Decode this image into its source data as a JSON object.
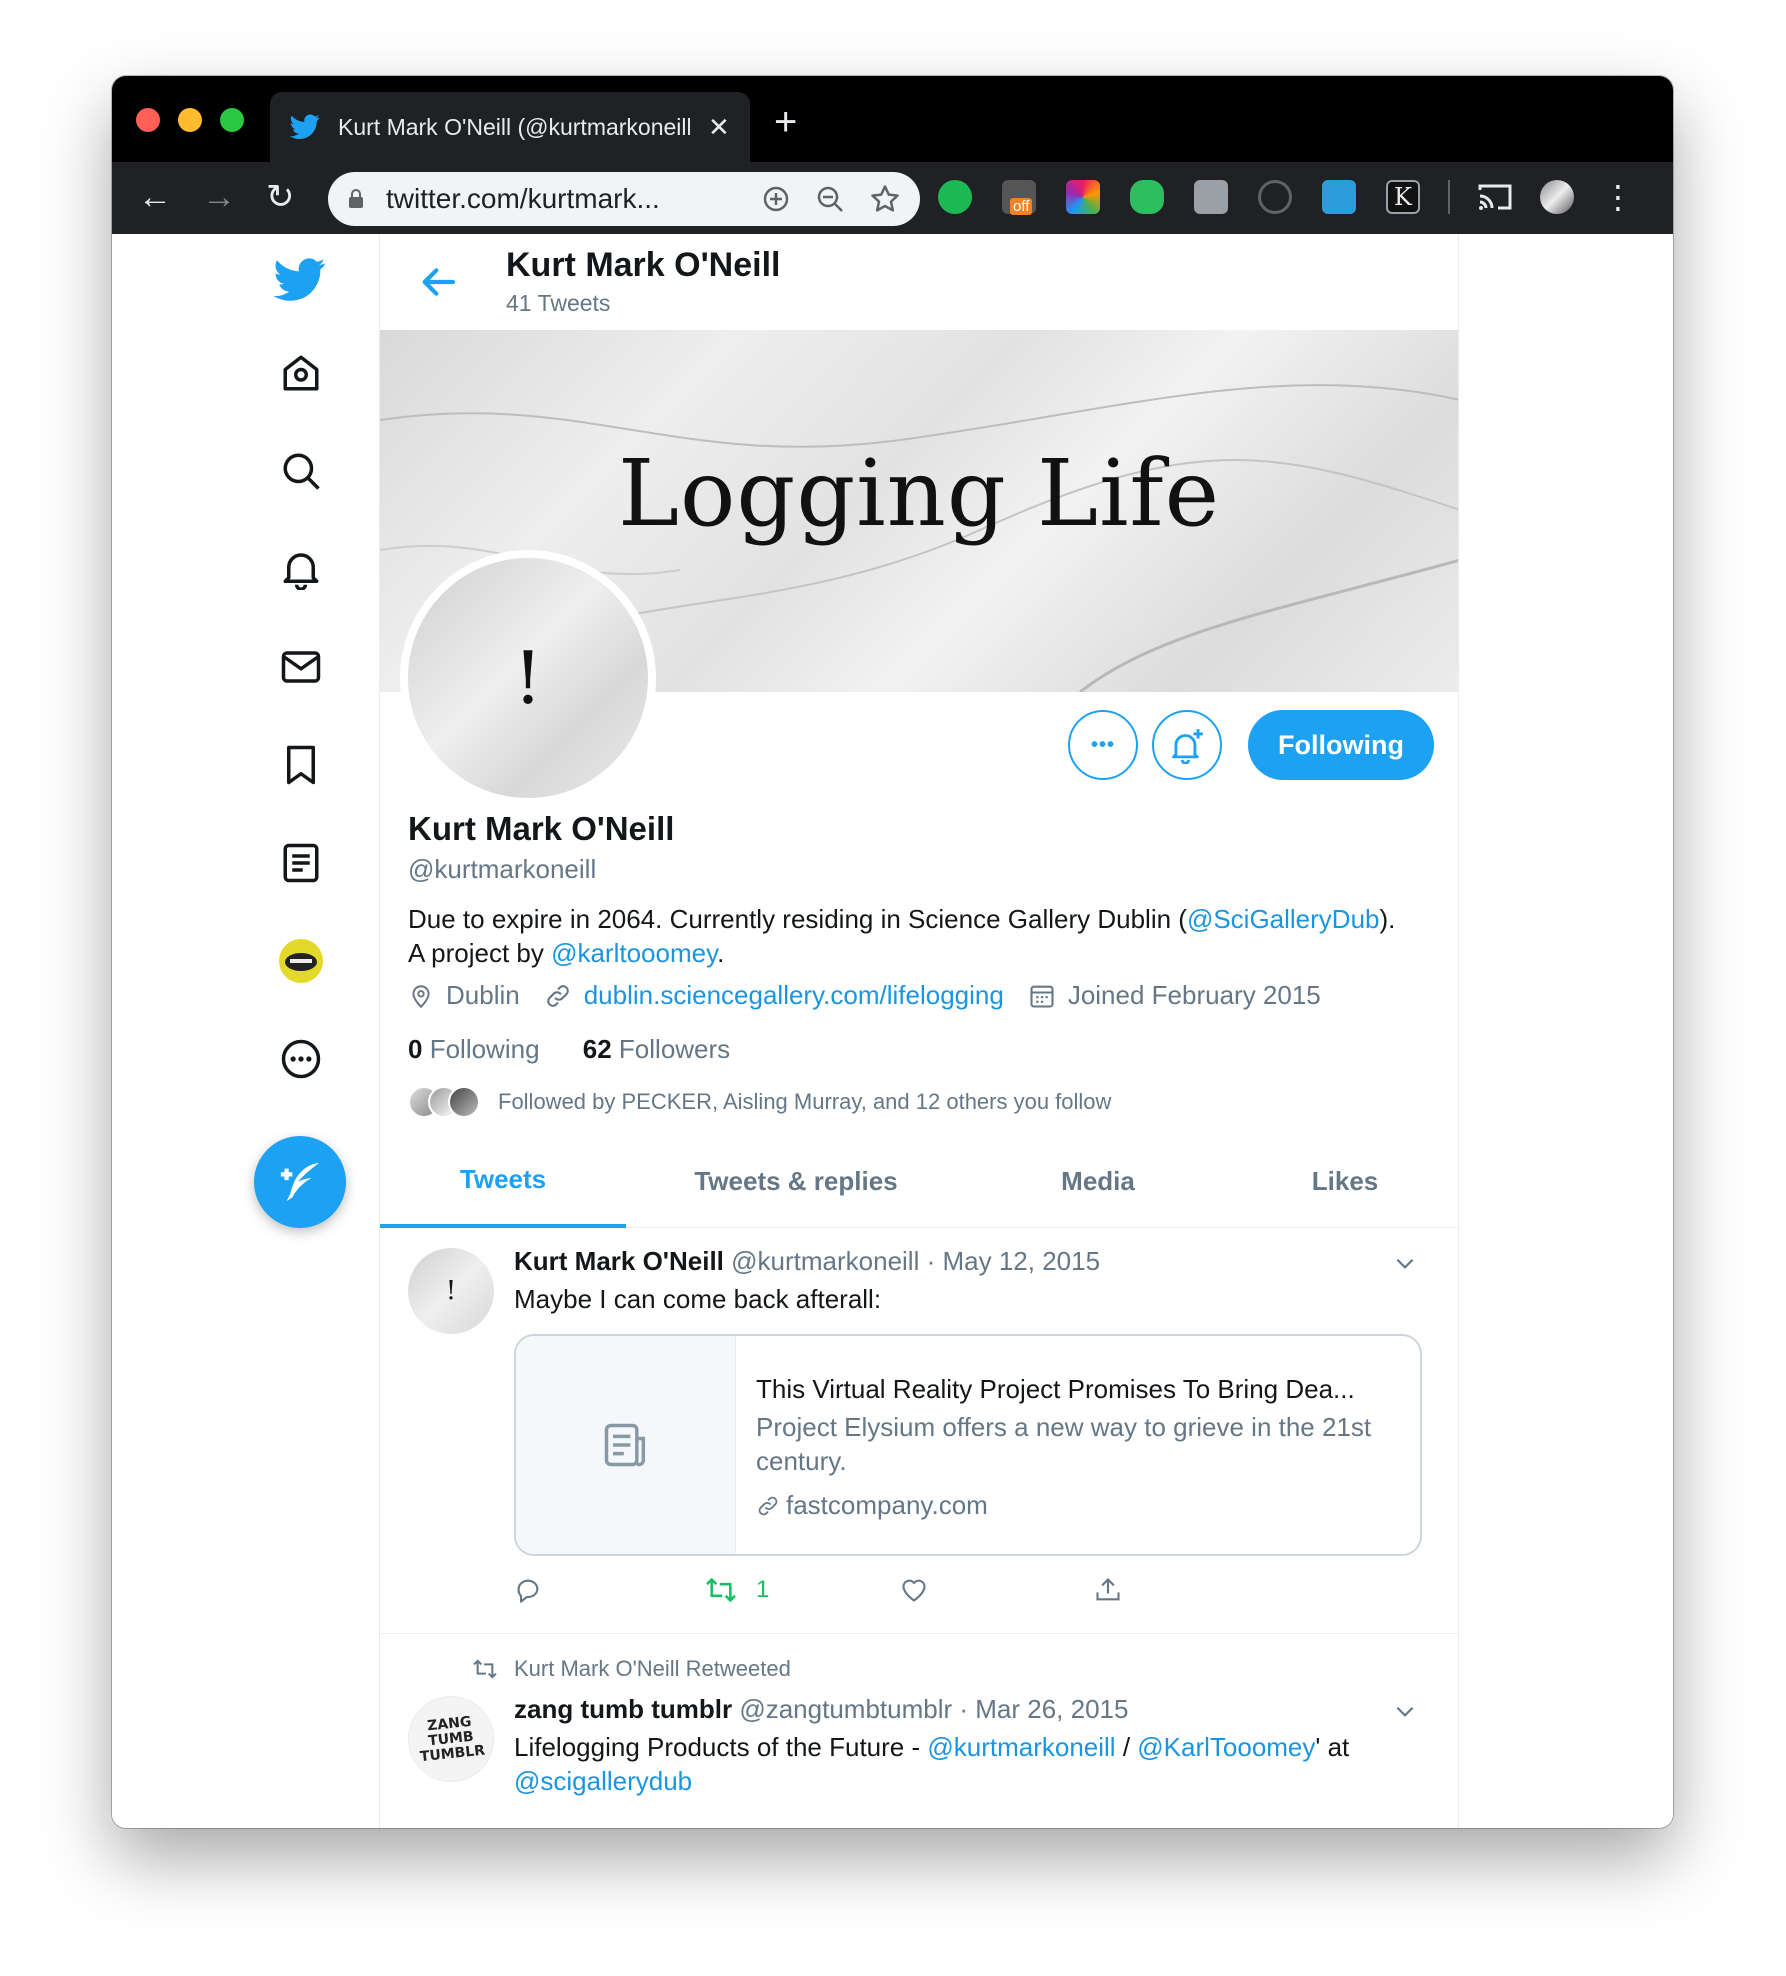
{
  "browser": {
    "tab_title": "Kurt Mark O'Neill (@kurtmarkoneill)",
    "tab_close": "✕",
    "new_tab": "+",
    "url": "twitter.com/kurtmark...",
    "back": "←",
    "forward": "→",
    "reload": "↻",
    "menu": "⋮",
    "ext_badge": "off",
    "accent": "#1da1f2"
  },
  "header": {
    "name": "Kurt Mark O'Neill",
    "tweet_count": "41 Tweets"
  },
  "banner": {
    "text": "Logging Life"
  },
  "profile": {
    "avatar_mark": "!",
    "name": "Kurt Mark O'Neill",
    "handle": "@kurtmarkoneill",
    "bio_1": "Due to expire in 2064. Currently residing in Science Gallery Dublin (",
    "bio_mention_1": "@SciGalleryDub",
    "bio_2": "). A project by ",
    "bio_mention_2": "@karltooomey",
    "bio_3": ".",
    "location": "Dublin",
    "website": "dublin.sciencegallery.com/lifelogging",
    "joined": "Joined February 2015",
    "following_count": "0",
    "following_label": "Following",
    "followers_count": "62",
    "followers_label": "Followers",
    "followed_by": "Followed by PECKER, Aisling Murray, and 12 others you follow",
    "following_button": "Following",
    "more_button": "•••"
  },
  "tabs": [
    {
      "label": "Tweets"
    },
    {
      "label": "Tweets & replies"
    },
    {
      "label": "Media"
    },
    {
      "label": "Likes"
    }
  ],
  "tweets": [
    {
      "avatar_mark": "!",
      "name": "Kurt Mark O'Neill",
      "handle": "@kurtmarkoneill",
      "date": "· May 12, 2015",
      "text": "Maybe I can come back afterall:",
      "card": {
        "title": "This Virtual Reality Project Promises To Bring Dea...",
        "description": "Project Elysium offers a new way to grieve in the 21st century.",
        "domain": "fastcompany.com"
      },
      "retweet_count": "1"
    },
    {
      "retweeted_by": "Kurt Mark O'Neill Retweeted",
      "avatar_text": "ZANG TUMB TUMBLR",
      "name": "zang tumb tumblr",
      "handle": "@zangtumbtumblr",
      "date": "· Mar 26, 2015",
      "text_1": "Lifelogging Products of the Future - ",
      "mention_1": "@kurtmarkoneill",
      "text_2": " / ",
      "mention_2": "@KarlTooomey",
      "text_3": "' at",
      "mention_3": "@scigallerydub"
    }
  ]
}
